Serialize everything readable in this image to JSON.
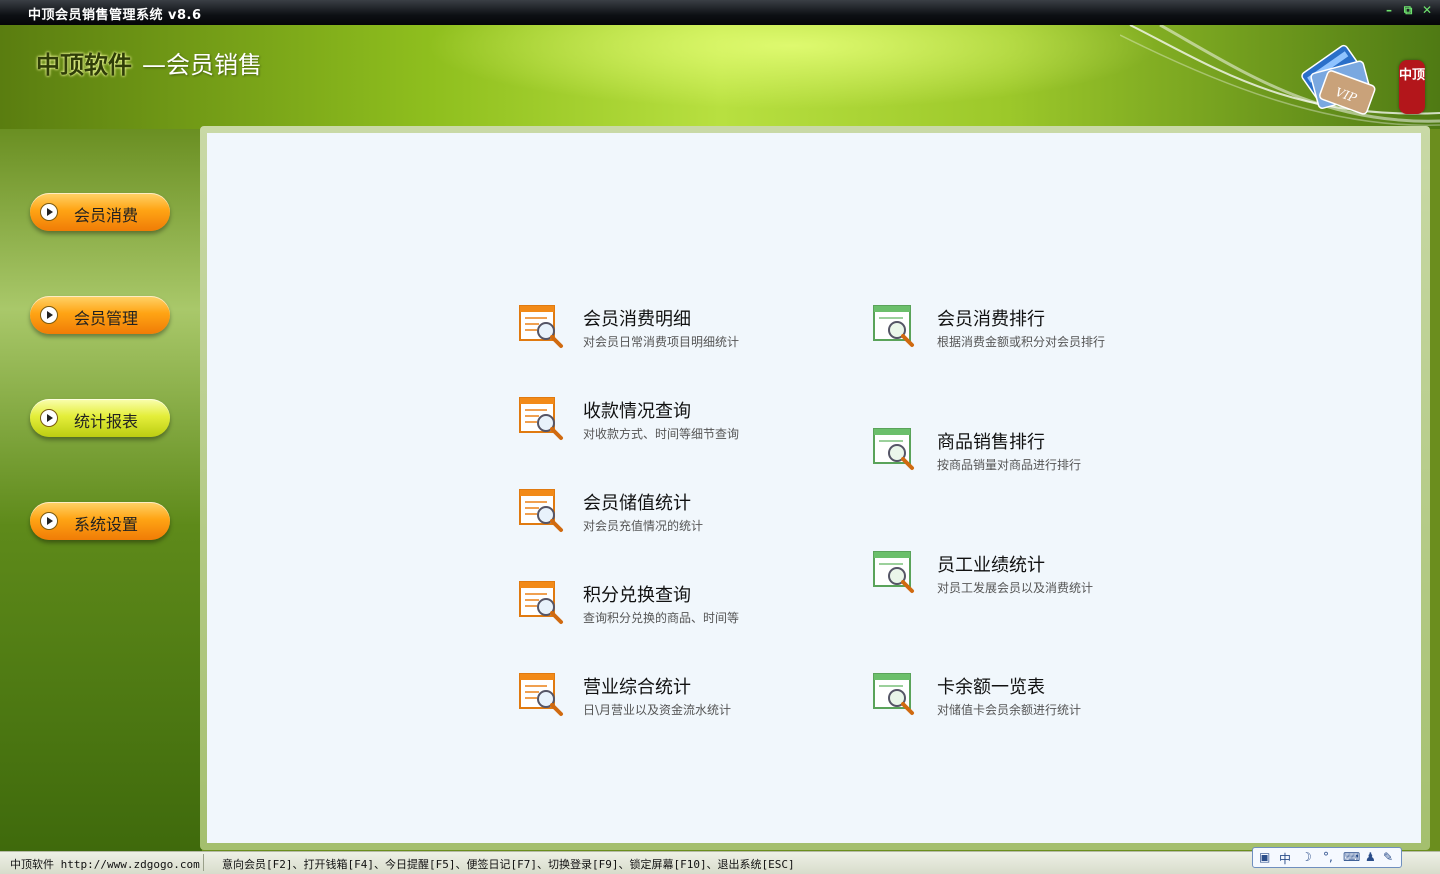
{
  "window": {
    "title": "中顶会员销售管理系统 v8.6",
    "controls": [
      "minimize",
      "restore",
      "close"
    ]
  },
  "header": {
    "company": "中顶软件",
    "module": "—会员销售",
    "seal_text": "中顶"
  },
  "sidebar": {
    "items": [
      {
        "label": "会员消费",
        "style": "orange"
      },
      {
        "label": "会员管理",
        "style": "orange"
      },
      {
        "label": "统计报表",
        "style": "yellow",
        "selected": true
      },
      {
        "label": "系统设置",
        "style": "orange"
      }
    ]
  },
  "reports": {
    "left": [
      {
        "name": "会员消费明细",
        "desc": "对会员日常消费项目明细统计"
      },
      {
        "name": "收款情况查询",
        "desc": "对收款方式、时间等细节查询"
      },
      {
        "name": "会员储值统计",
        "desc": "对会员充值情况的统计"
      },
      {
        "name": "积分兑换查询",
        "desc": "查询积分兑换的商品、时间等"
      },
      {
        "name": "营业综合统计",
        "desc": "日\\月营业以及资金流水统计"
      }
    ],
    "right": [
      {
        "name": "会员消费排行",
        "desc": "根据消费金额或积分对会员排行"
      },
      {
        "name": "商品销售排行",
        "desc": "按商品销量对商品进行排行"
      },
      {
        "name": "员工业绩统计",
        "desc": "对员工发展会员以及消费统计"
      },
      {
        "name": "卡余额一览表",
        "desc": "对储值卡会员余额进行统计"
      }
    ]
  },
  "statusbar": {
    "left": "中顶软件 http://www.zdgogo.com",
    "shortcuts": "意向会员[F2]、打开钱箱[F4]、今日提醒[F5]、便签日记[F7]、切换登录[F9]、锁定屏幕[F10]、退出系统[ESC]"
  },
  "ime": {
    "mode": "中",
    "symbols": [
      "☽",
      "°,",
      "⌨"
    ]
  },
  "colors": {
    "accent_orange": "#f08c0a",
    "accent_yellow": "#d8e43a",
    "banner_green": "#8fbf1e",
    "panel_bg": "#f1f7fc"
  }
}
